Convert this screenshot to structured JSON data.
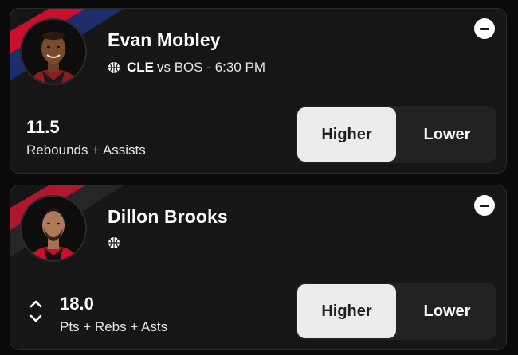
{
  "colors": {
    "background": "#0a0a0a",
    "card": "#161616",
    "accent_red": "#c8102e",
    "accent_navy": "#1d2d6b",
    "button_selected": "#ececec",
    "button_unselected": "#222222"
  },
  "picks": [
    {
      "player_name": "Evan Mobley",
      "team": "CLE",
      "matchup_rest": "vs BOS - 6:30 PM",
      "sport_icon": "basketball-icon",
      "line": "11.5",
      "stat": "Rebounds + Assists",
      "higher_label": "Higher",
      "lower_label": "Lower",
      "selected": "higher"
    },
    {
      "player_name": "Dillon Brooks",
      "sport_icon": "basketball-icon",
      "line": "18.0",
      "stat": "Pts + Rebs + Asts",
      "higher_label": "Higher",
      "lower_label": "Lower",
      "selected": "higher",
      "swap_icon": "chevron-up-down-icon"
    }
  ]
}
